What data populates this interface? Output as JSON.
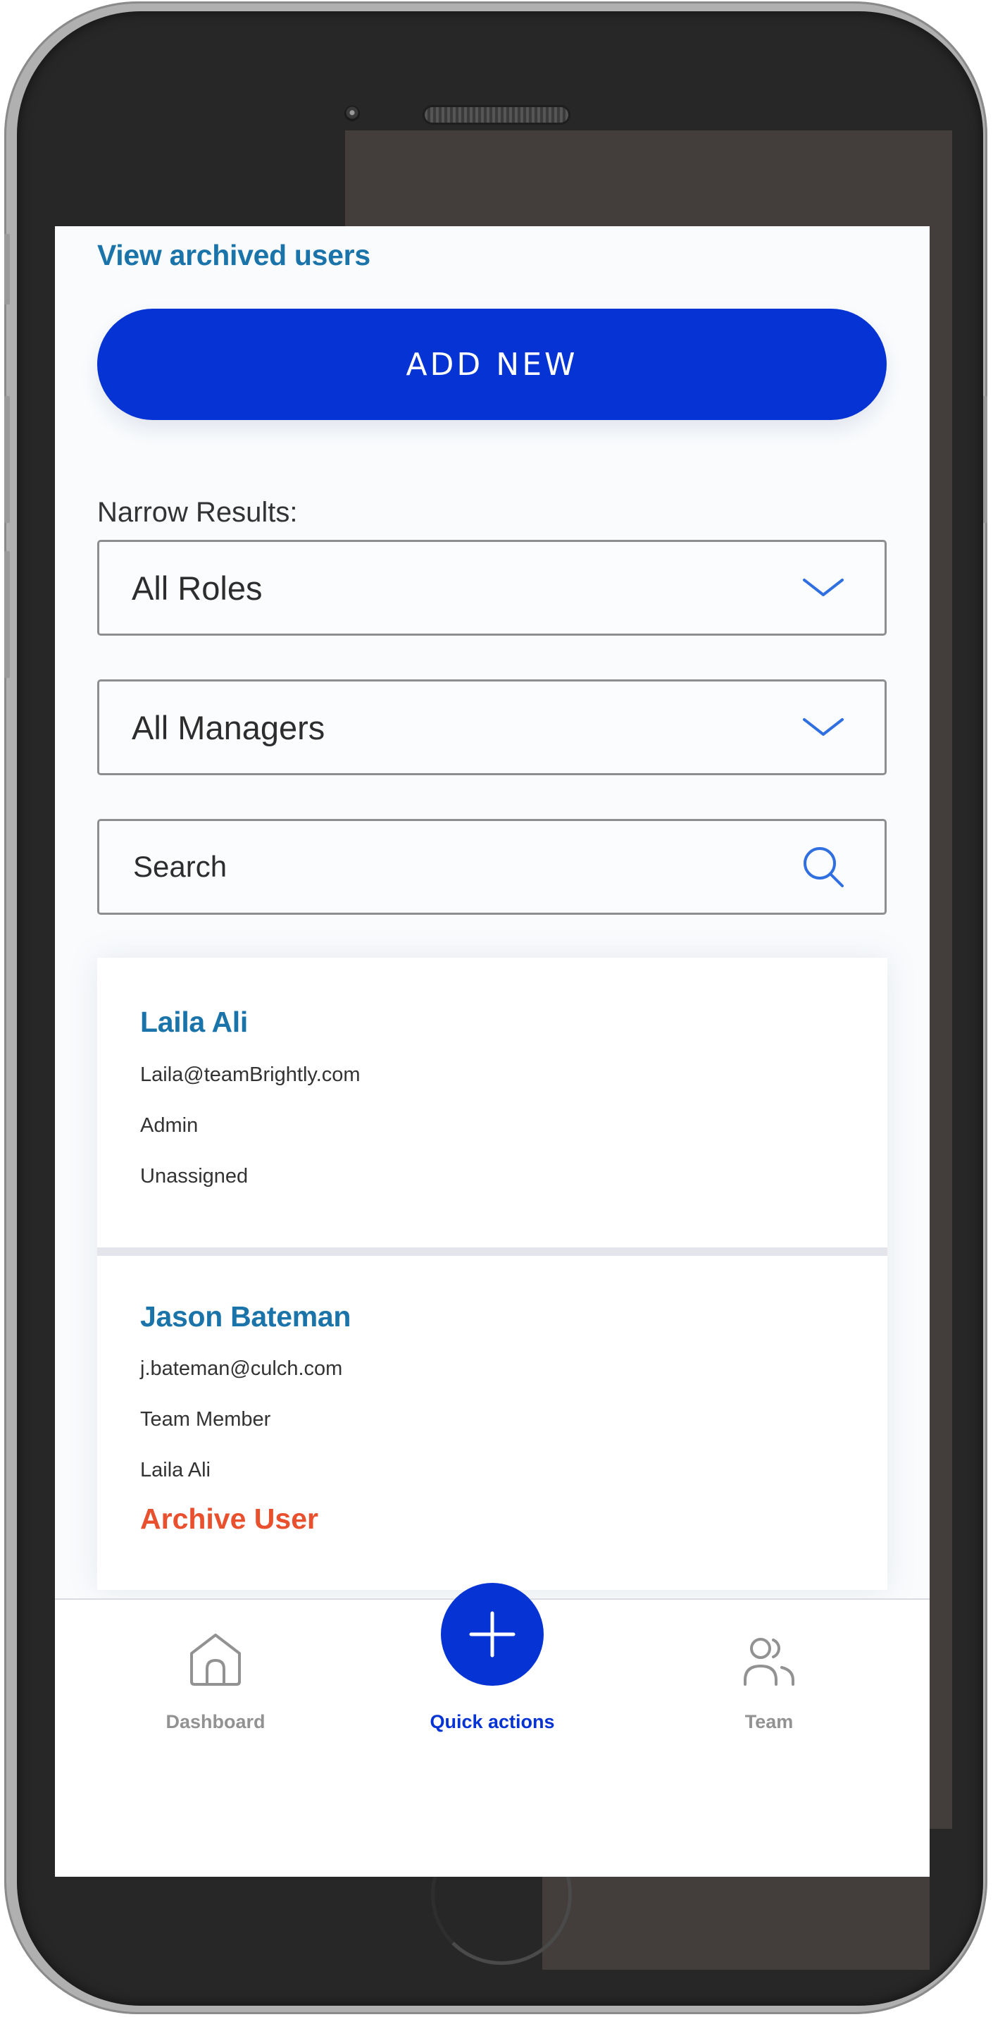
{
  "screen": {
    "archived_link": "View archived users",
    "add_new_label": "ADD NEW",
    "filters": {
      "label": "Narrow Results:",
      "roles_select": {
        "selected": "All Roles",
        "icon": "chevron-down-icon"
      },
      "managers_select": {
        "selected": "All Managers",
        "icon": "chevron-down-icon"
      },
      "search": {
        "placeholder": "Search",
        "value": "",
        "icon": "search-icon"
      }
    },
    "users": [
      {
        "name": "Laila Ali",
        "email": "Laila@teamBrightly.com",
        "role": "Admin",
        "manager": "Unassigned"
      },
      {
        "name": "Jason Bateman",
        "email": "j.bateman@culch.com",
        "role": "Team Member",
        "manager": "Laila Ali",
        "action": "Archive User"
      }
    ]
  },
  "bottom_nav": {
    "items": [
      {
        "label": "Dashboard",
        "icon": "home-icon",
        "active": false
      },
      {
        "label": "Quick actions",
        "icon": "plus-icon",
        "active": true
      },
      {
        "label": "Team",
        "icon": "team-icon",
        "active": false
      }
    ]
  },
  "colors": {
    "primary": "#0633d3",
    "link": "#1a74aa",
    "danger": "#e8502e",
    "icon_accent": "#2f6fe0",
    "nav_inactive": "#929292"
  }
}
